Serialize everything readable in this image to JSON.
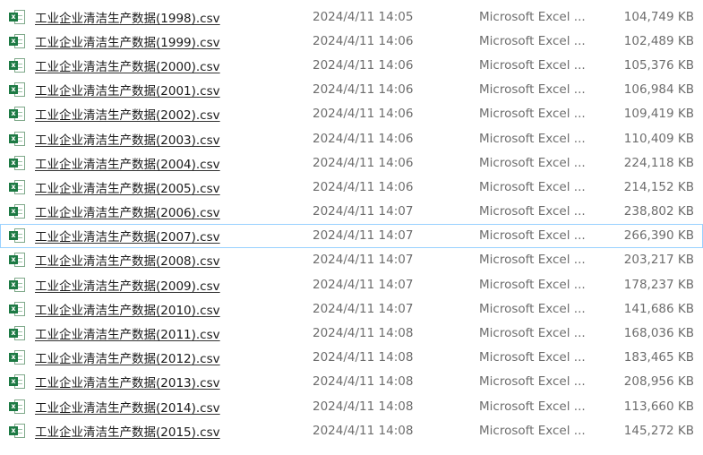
{
  "file_list": {
    "focused_index": 9,
    "icon": "excel-csv-file-icon",
    "icon_badge": "x",
    "colors": {
      "icon_green": "#1d7a44",
      "focus_border": "#99d1ff"
    },
    "rows": [
      {
        "name": "工业企业清洁生产数据(1998).csv",
        "modified": "2024/4/11 14:05",
        "type": "Microsoft Excel ...",
        "size": "104,749 KB"
      },
      {
        "name": "工业企业清洁生产数据(1999).csv",
        "modified": "2024/4/11 14:06",
        "type": "Microsoft Excel ...",
        "size": "102,489 KB"
      },
      {
        "name": "工业企业清洁生产数据(2000).csv",
        "modified": "2024/4/11 14:06",
        "type": "Microsoft Excel ...",
        "size": "105,376 KB"
      },
      {
        "name": "工业企业清洁生产数据(2001).csv",
        "modified": "2024/4/11 14:06",
        "type": "Microsoft Excel ...",
        "size": "106,984 KB"
      },
      {
        "name": "工业企业清洁生产数据(2002).csv",
        "modified": "2024/4/11 14:06",
        "type": "Microsoft Excel ...",
        "size": "109,419 KB"
      },
      {
        "name": "工业企业清洁生产数据(2003).csv",
        "modified": "2024/4/11 14:06",
        "type": "Microsoft Excel ...",
        "size": "110,409 KB"
      },
      {
        "name": "工业企业清洁生产数据(2004).csv",
        "modified": "2024/4/11 14:06",
        "type": "Microsoft Excel ...",
        "size": "224,118 KB"
      },
      {
        "name": "工业企业清洁生产数据(2005).csv",
        "modified": "2024/4/11 14:06",
        "type": "Microsoft Excel ...",
        "size": "214,152 KB"
      },
      {
        "name": "工业企业清洁生产数据(2006).csv",
        "modified": "2024/4/11 14:07",
        "type": "Microsoft Excel ...",
        "size": "238,802 KB"
      },
      {
        "name": "工业企业清洁生产数据(2007).csv",
        "modified": "2024/4/11 14:07",
        "type": "Microsoft Excel ...",
        "size": "266,390 KB"
      },
      {
        "name": "工业企业清洁生产数据(2008).csv",
        "modified": "2024/4/11 14:07",
        "type": "Microsoft Excel ...",
        "size": "203,217 KB"
      },
      {
        "name": "工业企业清洁生产数据(2009).csv",
        "modified": "2024/4/11 14:07",
        "type": "Microsoft Excel ...",
        "size": "178,237 KB"
      },
      {
        "name": "工业企业清洁生产数据(2010).csv",
        "modified": "2024/4/11 14:07",
        "type": "Microsoft Excel ...",
        "size": "141,686 KB"
      },
      {
        "name": "工业企业清洁生产数据(2011).csv",
        "modified": "2024/4/11 14:08",
        "type": "Microsoft Excel ...",
        "size": "168,036 KB"
      },
      {
        "name": "工业企业清洁生产数据(2012).csv",
        "modified": "2024/4/11 14:08",
        "type": "Microsoft Excel ...",
        "size": "183,465 KB"
      },
      {
        "name": "工业企业清洁生产数据(2013).csv",
        "modified": "2024/4/11 14:08",
        "type": "Microsoft Excel ...",
        "size": "208,956 KB"
      },
      {
        "name": "工业企业清洁生产数据(2014).csv",
        "modified": "2024/4/11 14:08",
        "type": "Microsoft Excel ...",
        "size": "113,660 KB"
      },
      {
        "name": "工业企业清洁生产数据(2015).csv",
        "modified": "2024/4/11 14:08",
        "type": "Microsoft Excel ...",
        "size": "145,272 KB"
      }
    ]
  }
}
